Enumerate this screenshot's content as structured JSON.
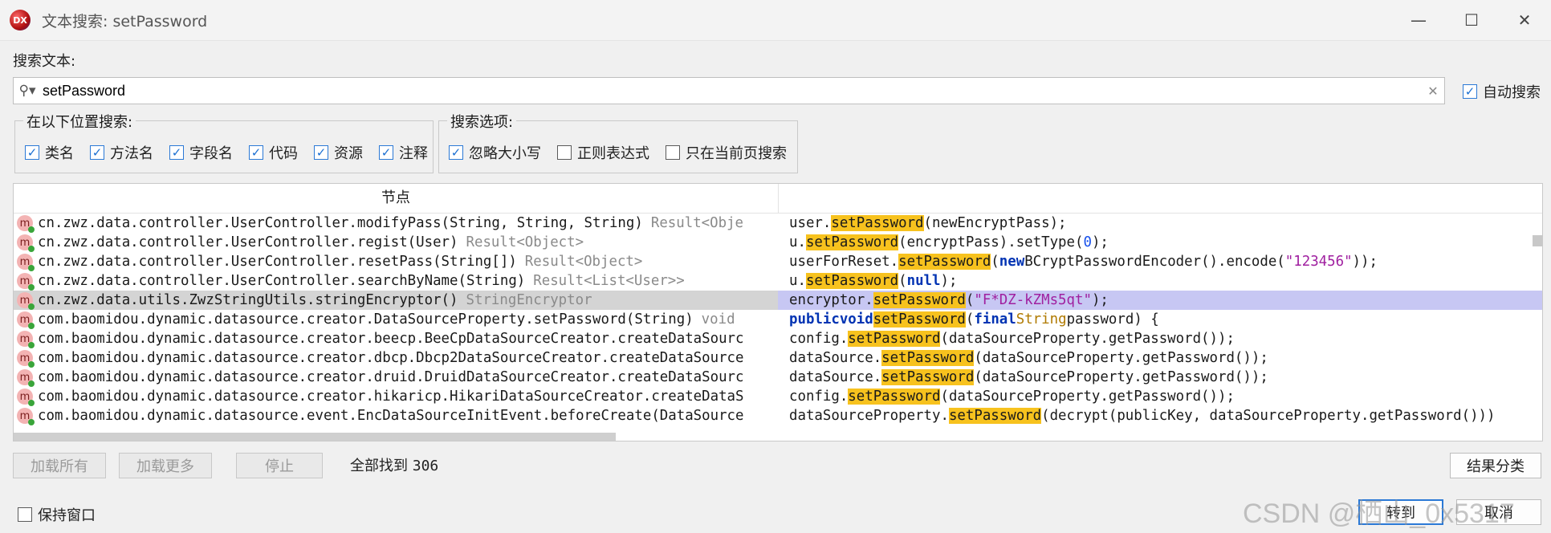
{
  "window": {
    "title": "文本搜索: setPassword",
    "app_icon": "jadx-logo",
    "app_icon_text": "DX"
  },
  "search": {
    "label": "搜索文本:",
    "value": "setPassword",
    "auto_search_label": "自动搜索",
    "auto_search_checked": true
  },
  "location_group": {
    "title": "在以下位置搜索:",
    "options": [
      {
        "label": "类名",
        "checked": true
      },
      {
        "label": "方法名",
        "checked": true
      },
      {
        "label": "字段名",
        "checked": true
      },
      {
        "label": "代码",
        "checked": true
      },
      {
        "label": "资源",
        "checked": true
      },
      {
        "label": "注释",
        "checked": true
      }
    ]
  },
  "options_group": {
    "title": "搜索选项:",
    "options": [
      {
        "label": "忽略大小写",
        "checked": true
      },
      {
        "label": "正则表达式",
        "checked": false
      },
      {
        "label": "只在当前页搜索",
        "checked": false
      }
    ]
  },
  "table": {
    "header_node": "节点",
    "rows": [
      {
        "node": "cn.zwz.data.controller.UserController.modifyPass(String, String, String)",
        "ret": "Result<Obje"
      },
      {
        "node": "cn.zwz.data.controller.UserController.regist(User)",
        "ret": "Result<Object>"
      },
      {
        "node": "cn.zwz.data.controller.UserController.resetPass(String[])",
        "ret": "Result<Object>"
      },
      {
        "node": "cn.zwz.data.controller.UserController.searchByName(String)",
        "ret": "Result<List<User>>"
      },
      {
        "node": "cn.zwz.data.utils.ZwzStringUtils.stringEncryptor()",
        "ret": "StringEncryptor"
      },
      {
        "node": "com.baomidou.dynamic.datasource.creator.DataSourceProperty.setPassword(String)",
        "ret": "void"
      },
      {
        "node": "com.baomidou.dynamic.datasource.creator.beecp.BeeCpDataSourceCreator.createDataSourc",
        "ret": ""
      },
      {
        "node": "com.baomidou.dynamic.datasource.creator.dbcp.Dbcp2DataSourceCreator.createDataSource",
        "ret": ""
      },
      {
        "node": "com.baomidou.dynamic.datasource.creator.druid.DruidDataSourceCreator.createDataSourc",
        "ret": ""
      },
      {
        "node": "com.baomidou.dynamic.datasource.creator.hikaricp.HikariDataSourceCreator.createDataS",
        "ret": ""
      },
      {
        "node": "com.baomidou.dynamic.datasource.event.EncDataSourceInitEvent.beforeCreate(DataSource",
        "ret": ""
      }
    ],
    "code": {
      "r0": [
        "user.",
        "setPassword",
        "(newEncryptPass);"
      ],
      "r1": [
        "u.",
        "setPassword",
        "(encryptPass).setType(",
        "0",
        ");"
      ],
      "r2": [
        "userForReset.",
        "setPassword",
        "(",
        "new",
        " BCryptPasswordEncoder().encode(",
        "\"123456\"",
        "));"
      ],
      "r3": [
        "u.",
        "setPassword",
        "(",
        "null",
        ");"
      ],
      "r4": [
        "encryptor.",
        "setPassword",
        "(",
        "\"F*DZ-kZMs5qt\"",
        ");"
      ],
      "r5": [
        "public",
        " ",
        "void",
        " ",
        "setPassword",
        "(",
        "final",
        " ",
        "String",
        " password) {"
      ],
      "r6": [
        "config.",
        "setPassword",
        "(dataSourceProperty.getPassword());"
      ],
      "r7": [
        "dataSource.",
        "setPassword",
        "(dataSourceProperty.getPassword());"
      ],
      "r8": [
        "dataSource.",
        "setPassword",
        "(dataSourceProperty.getPassword());"
      ],
      "r9": [
        "config.",
        "setPassword",
        "(dataSourceProperty.getPassword());"
      ],
      "r10": [
        "dataSourceProperty.",
        "setPassword",
        "(decrypt(publicKey, dataSourceProperty.getPassword()))"
      ]
    },
    "method_icon_letter": "m",
    "selected_row": 4
  },
  "buttons": {
    "load_all": "加载所有",
    "load_more": "加载更多",
    "stop": "停止",
    "group_results": "结果分类",
    "goto": "转到",
    "cancel": "取消"
  },
  "status": {
    "found_label": "全部找到",
    "found_count": "306"
  },
  "keep_window": {
    "label": "保持窗口",
    "checked": false
  },
  "watermark": "CSDN @栖山_0x5317"
}
